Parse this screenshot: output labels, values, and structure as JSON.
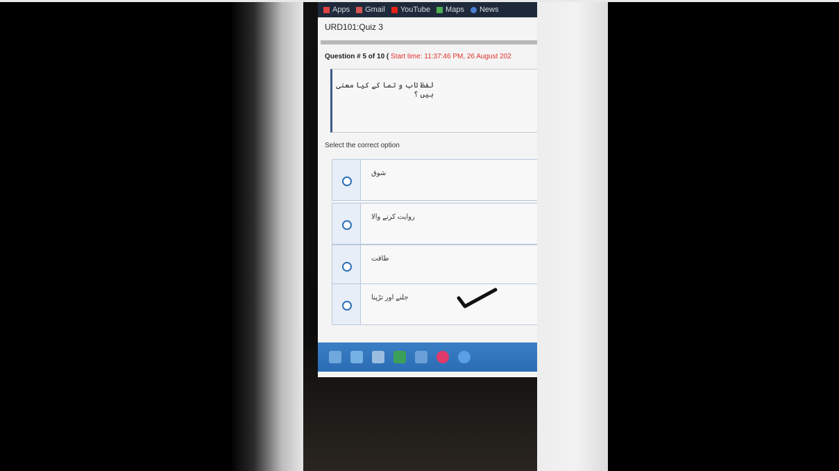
{
  "bookmarks": [
    {
      "label": "Apps",
      "icon": "apps-grid-icon",
      "color": "#e04343"
    },
    {
      "label": "Gmail",
      "icon": "gmail-icon",
      "color": "#d9534f"
    },
    {
      "label": "YouTube",
      "icon": "youtube-icon",
      "color": "#e62117"
    },
    {
      "label": "Maps",
      "icon": "maps-icon",
      "color": "#4caf50"
    },
    {
      "label": "News",
      "icon": "news-icon",
      "color": "#4a7fd4"
    }
  ],
  "quiz": {
    "title": "URD101:Quiz 3",
    "question_prefix": "Question # 5 of 10 (",
    "start_time": "Start time: 11:37:46 PM, 26 August 202",
    "question_text": "لفظ تاب و تما کے کیا معنی ہیں ؟",
    "select_label": "Select the correct option",
    "options": [
      {
        "text": "شوق"
      },
      {
        "text": "روایت کرنے والا"
      },
      {
        "text": "طاقت"
      },
      {
        "text": "جلنے اور تڑپنا"
      }
    ]
  },
  "taskbar": [
    {
      "icon": "windows-start-icon",
      "color": "#6fa8dc"
    },
    {
      "icon": "ie-icon",
      "color": "#76b1e6"
    },
    {
      "icon": "file-explorer-icon",
      "color": "#9bbde0"
    },
    {
      "icon": "app-green-icon",
      "color": "#3aa05a"
    },
    {
      "icon": "media-player-icon",
      "color": "#6aa0d8"
    },
    {
      "icon": "opera-icon",
      "color": "#e03a6c"
    },
    {
      "icon": "chrome-icon",
      "color": "#5aa0e6"
    }
  ]
}
